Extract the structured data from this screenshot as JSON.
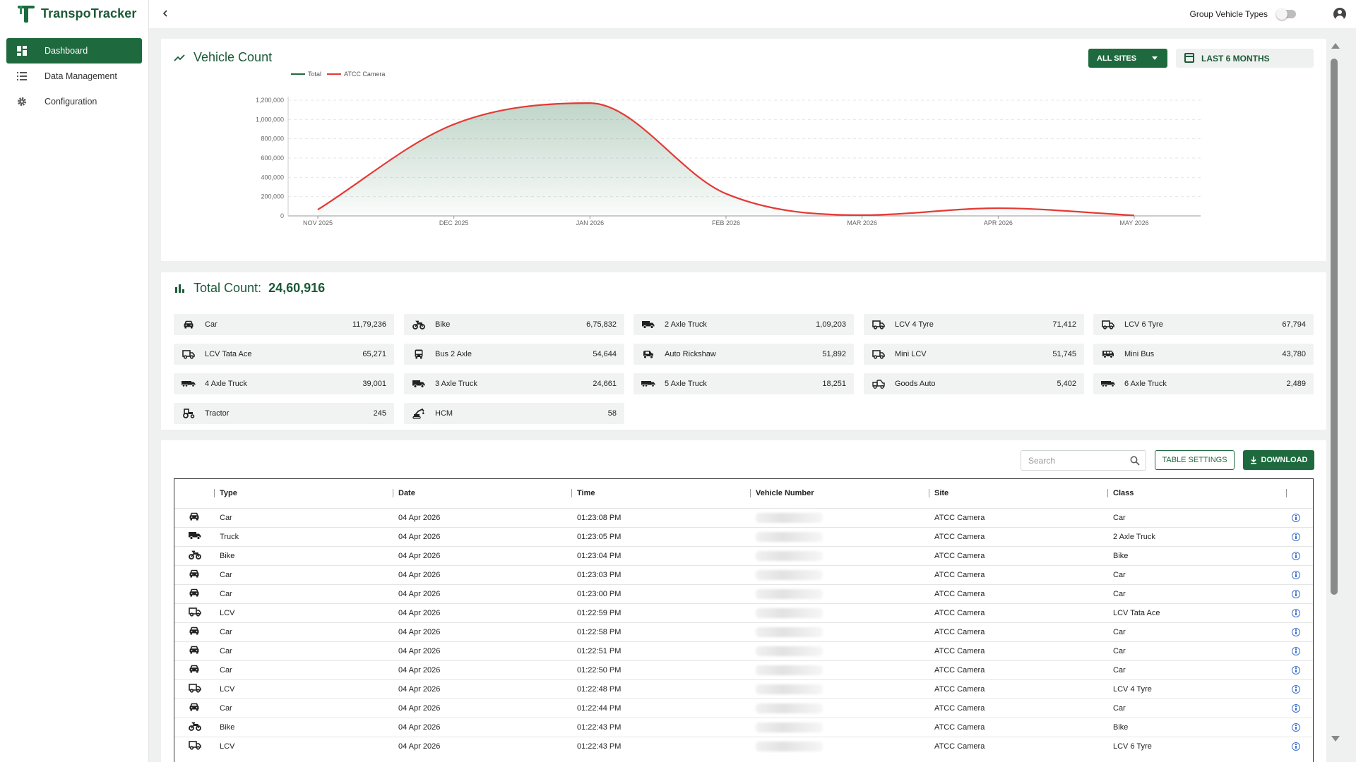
{
  "app": {
    "name": "TranspoTracker"
  },
  "sidebar": {
    "items": [
      {
        "label": "Dashboard",
        "icon": "dashboard-icon",
        "active": true
      },
      {
        "label": "Data Management",
        "icon": "list-icon",
        "active": false
      },
      {
        "label": "Configuration",
        "icon": "gear-icon",
        "active": false
      }
    ]
  },
  "topbar": {
    "group_label": "Group Vehicle Types",
    "group_toggle_on": false
  },
  "vehicle_count": {
    "title": "Vehicle Count",
    "sites_button": "ALL SITES",
    "range_button": "LAST 6 MONTHS"
  },
  "chart_data": {
    "type": "area",
    "x": [
      "NOV 2025",
      "DEC 2025",
      "JAN 2026",
      "FEB 2026",
      "MAR 2026",
      "APR 2026",
      "MAY 2026"
    ],
    "series": [
      {
        "name": "Total",
        "color": "#1e6a3e",
        "values": [
          65000,
          950000,
          1170000,
          230000,
          8000,
          80000,
          5000
        ]
      },
      {
        "name": "ATCC Camera",
        "color": "#e53935",
        "values": [
          65000,
          950000,
          1170000,
          230000,
          8000,
          80000,
          5000
        ]
      }
    ],
    "yticks": [
      0,
      200000,
      400000,
      600000,
      800000,
      1000000,
      1200000
    ],
    "ytick_labels": [
      "0",
      "200,000",
      "400,000",
      "600,000",
      "800,000",
      "1,000,000",
      "1,200,000"
    ],
    "ylim": [
      0,
      1200000
    ],
    "grid": true,
    "legend": "top-left"
  },
  "total_count": {
    "label": "Total Count:",
    "value": "24,60,916",
    "items": [
      {
        "name": "Car",
        "value": "11,79,236",
        "icon": "car-icon"
      },
      {
        "name": "Bike",
        "value": "6,75,832",
        "icon": "bike-icon"
      },
      {
        "name": "2 Axle Truck",
        "value": "1,09,203",
        "icon": "truck-icon"
      },
      {
        "name": "LCV 4 Tyre",
        "value": "71,412",
        "icon": "lcv-icon"
      },
      {
        "name": "LCV 6 Tyre",
        "value": "67,794",
        "icon": "lcv-icon"
      },
      {
        "name": "LCV Tata Ace",
        "value": "65,271",
        "icon": "lcv-icon"
      },
      {
        "name": "Bus 2 Axle",
        "value": "54,644",
        "icon": "bus-icon"
      },
      {
        "name": "Auto Rickshaw",
        "value": "51,892",
        "icon": "auto-rickshaw-icon"
      },
      {
        "name": "Mini LCV",
        "value": "51,745",
        "icon": "lcv-icon"
      },
      {
        "name": "Mini Bus",
        "value": "43,780",
        "icon": "minibus-icon"
      },
      {
        "name": "4 Axle Truck",
        "value": "39,001",
        "icon": "long-truck-icon"
      },
      {
        "name": "3 Axle Truck",
        "value": "24,661",
        "icon": "truck-icon"
      },
      {
        "name": "5 Axle Truck",
        "value": "18,251",
        "icon": "long-truck-icon"
      },
      {
        "name": "Goods Auto",
        "value": "5,402",
        "icon": "goods-auto-icon"
      },
      {
        "name": "6 Axle Truck",
        "value": "2,489",
        "icon": "long-truck-icon"
      },
      {
        "name": "Tractor",
        "value": "245",
        "icon": "tractor-icon"
      },
      {
        "name": "HCM",
        "value": "58",
        "icon": "hcm-icon"
      }
    ]
  },
  "table": {
    "search_placeholder": "Search",
    "settings_label": "TABLE SETTINGS",
    "download_label": "DOWNLOAD",
    "columns": [
      "Type",
      "Date",
      "Time",
      "Vehicle Number",
      "Site",
      "Class"
    ],
    "rows": [
      {
        "icon": "car-icon",
        "type": "Car",
        "date": "04 Apr 2026",
        "time": "01:23:08 PM",
        "site": "ATCC Camera",
        "class": "Car"
      },
      {
        "icon": "truck-icon",
        "type": "Truck",
        "date": "04 Apr 2026",
        "time": "01:23:05 PM",
        "site": "ATCC Camera",
        "class": "2 Axle Truck"
      },
      {
        "icon": "bike-icon",
        "type": "Bike",
        "date": "04 Apr 2026",
        "time": "01:23:04 PM",
        "site": "ATCC Camera",
        "class": "Bike"
      },
      {
        "icon": "car-icon",
        "type": "Car",
        "date": "04 Apr 2026",
        "time": "01:23:03 PM",
        "site": "ATCC Camera",
        "class": "Car"
      },
      {
        "icon": "car-icon",
        "type": "Car",
        "date": "04 Apr 2026",
        "time": "01:23:00 PM",
        "site": "ATCC Camera",
        "class": "Car"
      },
      {
        "icon": "lcv-icon",
        "type": "LCV",
        "date": "04 Apr 2026",
        "time": "01:22:59 PM",
        "site": "ATCC Camera",
        "class": "LCV Tata Ace"
      },
      {
        "icon": "car-icon",
        "type": "Car",
        "date": "04 Apr 2026",
        "time": "01:22:58 PM",
        "site": "ATCC Camera",
        "class": "Car"
      },
      {
        "icon": "car-icon",
        "type": "Car",
        "date": "04 Apr 2026",
        "time": "01:22:51 PM",
        "site": "ATCC Camera",
        "class": "Car"
      },
      {
        "icon": "car-icon",
        "type": "Car",
        "date": "04 Apr 2026",
        "time": "01:22:50 PM",
        "site": "ATCC Camera",
        "class": "Car"
      },
      {
        "icon": "lcv-icon",
        "type": "LCV",
        "date": "04 Apr 2026",
        "time": "01:22:48 PM",
        "site": "ATCC Camera",
        "class": "LCV 4 Tyre"
      },
      {
        "icon": "car-icon",
        "type": "Car",
        "date": "04 Apr 2026",
        "time": "01:22:44 PM",
        "site": "ATCC Camera",
        "class": "Car"
      },
      {
        "icon": "bike-icon",
        "type": "Bike",
        "date": "04 Apr 2026",
        "time": "01:22:43 PM",
        "site": "ATCC Camera",
        "class": "Bike"
      },
      {
        "icon": "lcv-icon",
        "type": "LCV",
        "date": "04 Apr 2026",
        "time": "01:22:43 PM",
        "site": "ATCC Camera",
        "class": "LCV 6 Tyre"
      }
    ]
  }
}
